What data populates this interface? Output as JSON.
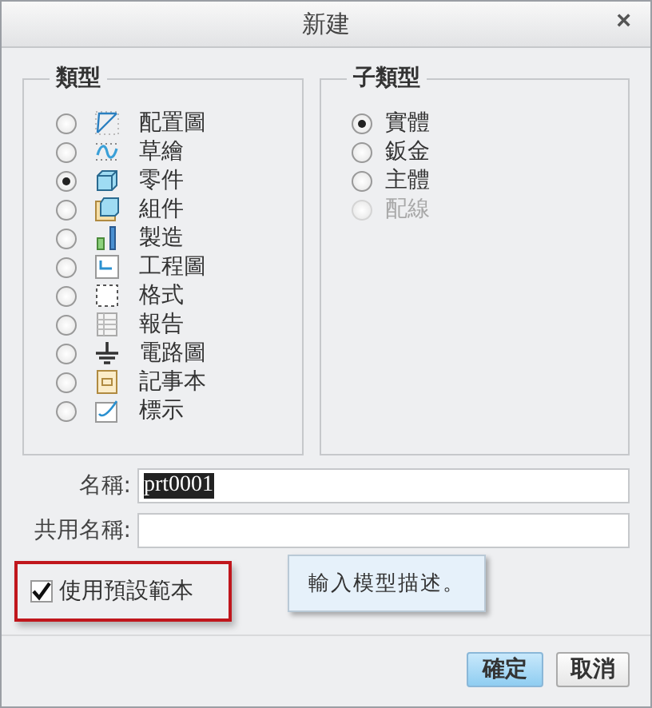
{
  "window": {
    "title": "新建",
    "close": "×"
  },
  "type_group": {
    "title": "類型",
    "options": [
      {
        "label": "配置圖",
        "selected": false
      },
      {
        "label": "草繪",
        "selected": false
      },
      {
        "label": "零件",
        "selected": true
      },
      {
        "label": "組件",
        "selected": false
      },
      {
        "label": "製造",
        "selected": false
      },
      {
        "label": "工程圖",
        "selected": false
      },
      {
        "label": "格式",
        "selected": false
      },
      {
        "label": "報告",
        "selected": false
      },
      {
        "label": "電路圖",
        "selected": false
      },
      {
        "label": "記事本",
        "selected": false
      },
      {
        "label": "標示",
        "selected": false
      }
    ]
  },
  "subtype_group": {
    "title": "子類型",
    "options": [
      {
        "label": "實體",
        "selected": true,
        "disabled": false
      },
      {
        "label": "鈑金",
        "selected": false,
        "disabled": false
      },
      {
        "label": "主體",
        "selected": false,
        "disabled": false
      },
      {
        "label": "配線",
        "selected": false,
        "disabled": true
      }
    ]
  },
  "name_field": {
    "label": "名稱:",
    "value": "prt0001",
    "text_selected": true
  },
  "common_name_field": {
    "label": "共用名稱:"
  },
  "default_template": {
    "label": "使用預設範本",
    "checked": true,
    "highlighted": true
  },
  "tooltip": "輸入模型描述。",
  "buttons": [
    {
      "label": "確定",
      "default": true
    },
    {
      "label": "取消",
      "default": false
    }
  ]
}
